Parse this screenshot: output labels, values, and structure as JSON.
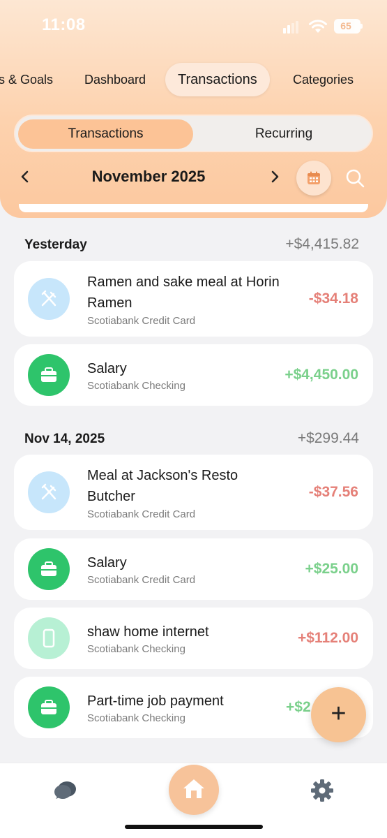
{
  "status": {
    "time": "11:08",
    "battery": "65"
  },
  "top_tabs": [
    {
      "label": "s & Goals"
    },
    {
      "label": "Dashboard"
    },
    {
      "label": "Transactions"
    },
    {
      "label": "Categories"
    }
  ],
  "segment": {
    "active": "Transactions",
    "inactive": "Recurring"
  },
  "month": {
    "label": "November 2025"
  },
  "sections": [
    {
      "title": "Yesterday",
      "total": "+$4,415.82",
      "items": [
        {
          "title": "Ramen and sake meal at Horin Ramen",
          "account": "Scotiabank Credit Card",
          "amount": "-$34.18",
          "icon": "fork-knife-icon"
        },
        {
          "title": "Salary",
          "account": "Scotiabank Checking",
          "amount": "+$4,450.00",
          "icon": "briefcase-icon"
        }
      ]
    },
    {
      "title": "Nov 14, 2025",
      "total": "+$299.44",
      "items": [
        {
          "title": "Meal at Jackson's Resto Butcher",
          "account": "Scotiabank Credit Card",
          "amount": "-$37.56",
          "icon": "fork-knife-icon"
        },
        {
          "title": "Salary",
          "account": "Scotiabank Credit Card",
          "amount": "+$25.00",
          "icon": "briefcase-icon"
        },
        {
          "title": "shaw home internet",
          "account": "Scotiabank Checking",
          "amount": "+$112.00",
          "icon": "phone-icon"
        },
        {
          "title": "Part-time job payment",
          "account": "Scotiabank Checking",
          "amount": "+$2",
          "icon": "briefcase-icon"
        }
      ]
    }
  ],
  "fab": {
    "symbol": "+"
  },
  "colors": {
    "accent": "#fcc396",
    "negative": "#e58078",
    "positive": "#7ad08b",
    "salary_icon_bg": "#2ec46b",
    "food_icon_bg": "#c7e6fb"
  }
}
